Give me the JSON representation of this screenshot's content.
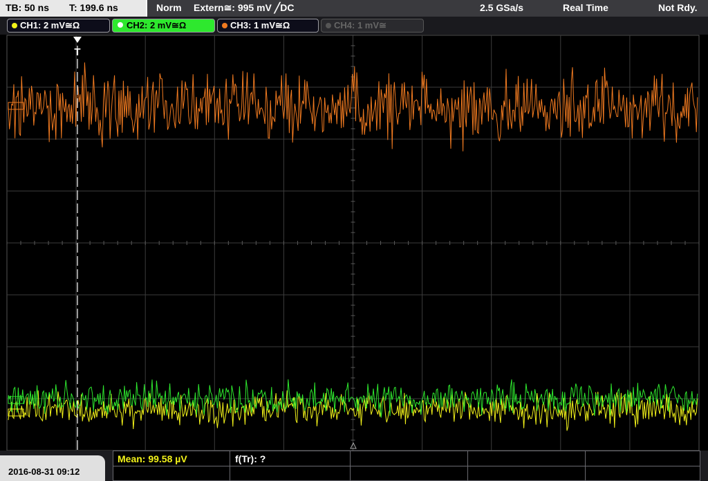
{
  "header": {
    "timebase": "TB: 50 ns",
    "trigger_time": "T: 199.6 ns",
    "trigger_mode": "Norm",
    "trigger_source": "Extern≅: 995 mV ╱DC",
    "sample_rate": "2.5 GSa/s",
    "acquisition": "Real Time",
    "status": "Not Rdy."
  },
  "channels": [
    {
      "label": "CH1: 2 mV≅Ω",
      "color": "#f2f21a",
      "active": false,
      "enabled": true
    },
    {
      "label": "CH2: 2 mV≅Ω",
      "color": "#2ee82e",
      "active": true,
      "enabled": true
    },
    {
      "label": "CH3: 1 mV≅Ω",
      "color": "#f07a20",
      "active": false,
      "enabled": true
    },
    {
      "label": "CH4: 1 mV≅",
      "color": "#777777",
      "active": false,
      "enabled": false
    }
  ],
  "trigger_marker": "T",
  "footer": {
    "datetime": "2016-08-31 09:12",
    "mean": "Mean: 99.58 µV",
    "ftr": "f(Tr): ?"
  },
  "colors": {
    "ch1": "#f2f21a",
    "ch2": "#2ee82e",
    "ch3": "#f07a20",
    "grid": "#3c3c3c",
    "screen_bg": "#000000",
    "active_tab": "#2ee82e"
  }
}
